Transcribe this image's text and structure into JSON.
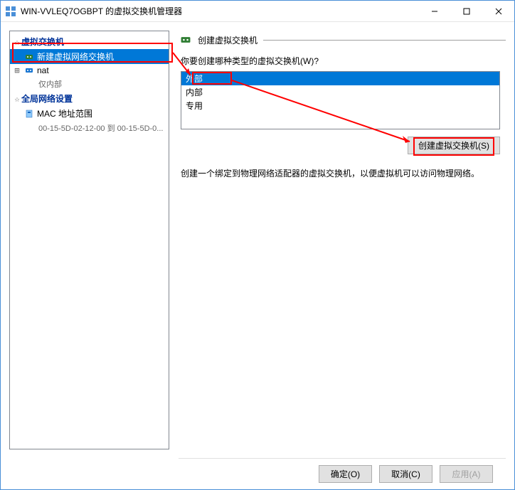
{
  "title": "WIN-VVLEQ7OGBPT 的虚拟交换机管理器",
  "tree": {
    "section1": "虚拟交换机",
    "newSwitch": "新建虚拟网络交换机",
    "nat": "nat",
    "natSub": "仅内部",
    "section2": "全局网络设置",
    "mac": "MAC 地址范围",
    "macSub": "00-15-5D-02-12-00 到 00-15-5D-0..."
  },
  "panel": {
    "title": "创建虚拟交换机",
    "prompt": "你要创建哪种类型的虚拟交换机(W)?",
    "options": {
      "external": "外部",
      "internal": "内部",
      "private": "专用"
    },
    "createBtn": "创建虚拟交换机(S)",
    "desc": "创建一个绑定到物理网络适配器的虚拟交换机，以便虚拟机可以访问物理网络。"
  },
  "footer": {
    "ok": "确定(O)",
    "cancel": "取消(C)",
    "apply": "应用(A)"
  }
}
